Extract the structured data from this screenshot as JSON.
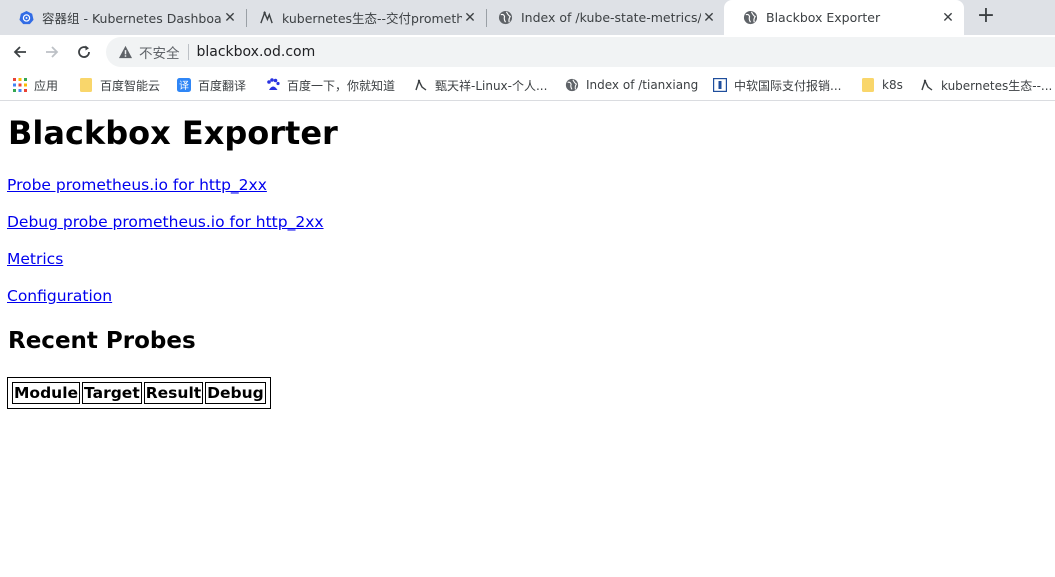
{
  "tabs": [
    {
      "title": "容器组 - Kubernetes Dashboard",
      "icon": "kubernetes-icon",
      "active": false
    },
    {
      "title": "kubernetes生态--交付prometheus",
      "icon": "blog-icon",
      "active": false
    },
    {
      "title": "Index of /kube-state-metrics/",
      "icon": "globe-icon",
      "active": false
    },
    {
      "title": "Blackbox Exporter",
      "icon": "globe-icon",
      "active": true
    }
  ],
  "toolbar": {
    "insecure_label": "不安全",
    "url": "blackbox.od.com"
  },
  "bookmarks": [
    {
      "label": "应用",
      "icon": "apps-grid-icon"
    },
    {
      "label": "百度智能云",
      "icon": "folder-icon"
    },
    {
      "label": "百度翻译",
      "icon": "translate-icon"
    },
    {
      "label": "百度一下，你就知道",
      "icon": "baidu-paw-icon"
    },
    {
      "label": "甄天祥-Linux-个人...",
      "icon": "blog-icon"
    },
    {
      "label": "Index of /tianxiang",
      "icon": "globe-icon"
    },
    {
      "label": "中软国际支付报销...",
      "icon": "bookmark-icon"
    },
    {
      "label": "k8s",
      "icon": "folder-icon"
    },
    {
      "label": "kubernetes生态--...",
      "icon": "blog-icon"
    }
  ],
  "page": {
    "title": "Blackbox Exporter",
    "links": [
      "Probe prometheus.io for http_2xx",
      "Debug probe prometheus.io for http_2xx",
      "Metrics",
      "Configuration"
    ],
    "recent_heading": "Recent Probes",
    "table_headers": [
      "Module",
      "Target",
      "Result",
      "Debug"
    ]
  },
  "colors": {
    "link": "#0000ee",
    "tabstrip_bg": "#dee1e6",
    "omnibox_bg": "#f1f3f4",
    "kubernetes_blue": "#326ce5",
    "folder_yellow": "#f9d66b",
    "translate_blue": "#2f86f6",
    "baidu_blue": "#2932e1"
  }
}
